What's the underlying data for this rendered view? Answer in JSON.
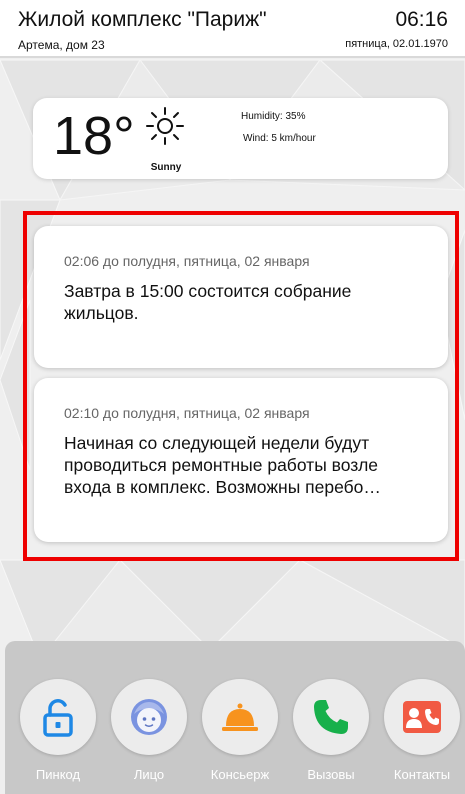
{
  "header": {
    "complex_name": "Жилой комплекс \"Париж\"",
    "time": "06:16",
    "address": "Артема, дом 23",
    "date": "пятница, 02.01.1970"
  },
  "weather": {
    "temperature": "18°",
    "icon": "sun-icon",
    "condition": "Sunny",
    "humidity": "Humidity: 35%",
    "wind": "Wind: 5 km/hour"
  },
  "messages": [
    {
      "time": "02:06 до полудня, пятница, 02 января",
      "text": "Завтра в 15:00 состоится собрание жильцов."
    },
    {
      "time": "02:10 до полудня, пятница, 02 января",
      "text": "Начиная со следующей недели будут проводиться ремонтные работы возле входа в комплекс. Возможны перебо…"
    }
  ],
  "dock": [
    {
      "label": "Пинкод",
      "icon": "unlock-icon",
      "color": "#1e88e5"
    },
    {
      "label": "Лицо",
      "icon": "face-icon",
      "color": "#7a93e0"
    },
    {
      "label": "Консьерж",
      "icon": "concierge-bell-icon",
      "color": "#f7931e"
    },
    {
      "label": "Вызовы",
      "icon": "phone-icon",
      "color": "#17b04b"
    },
    {
      "label": "Контакты",
      "icon": "contact-card-icon",
      "color": "#f15a43"
    }
  ],
  "colors": {
    "highlight": "#ee0000",
    "dock_background": "#c8c8c8"
  }
}
